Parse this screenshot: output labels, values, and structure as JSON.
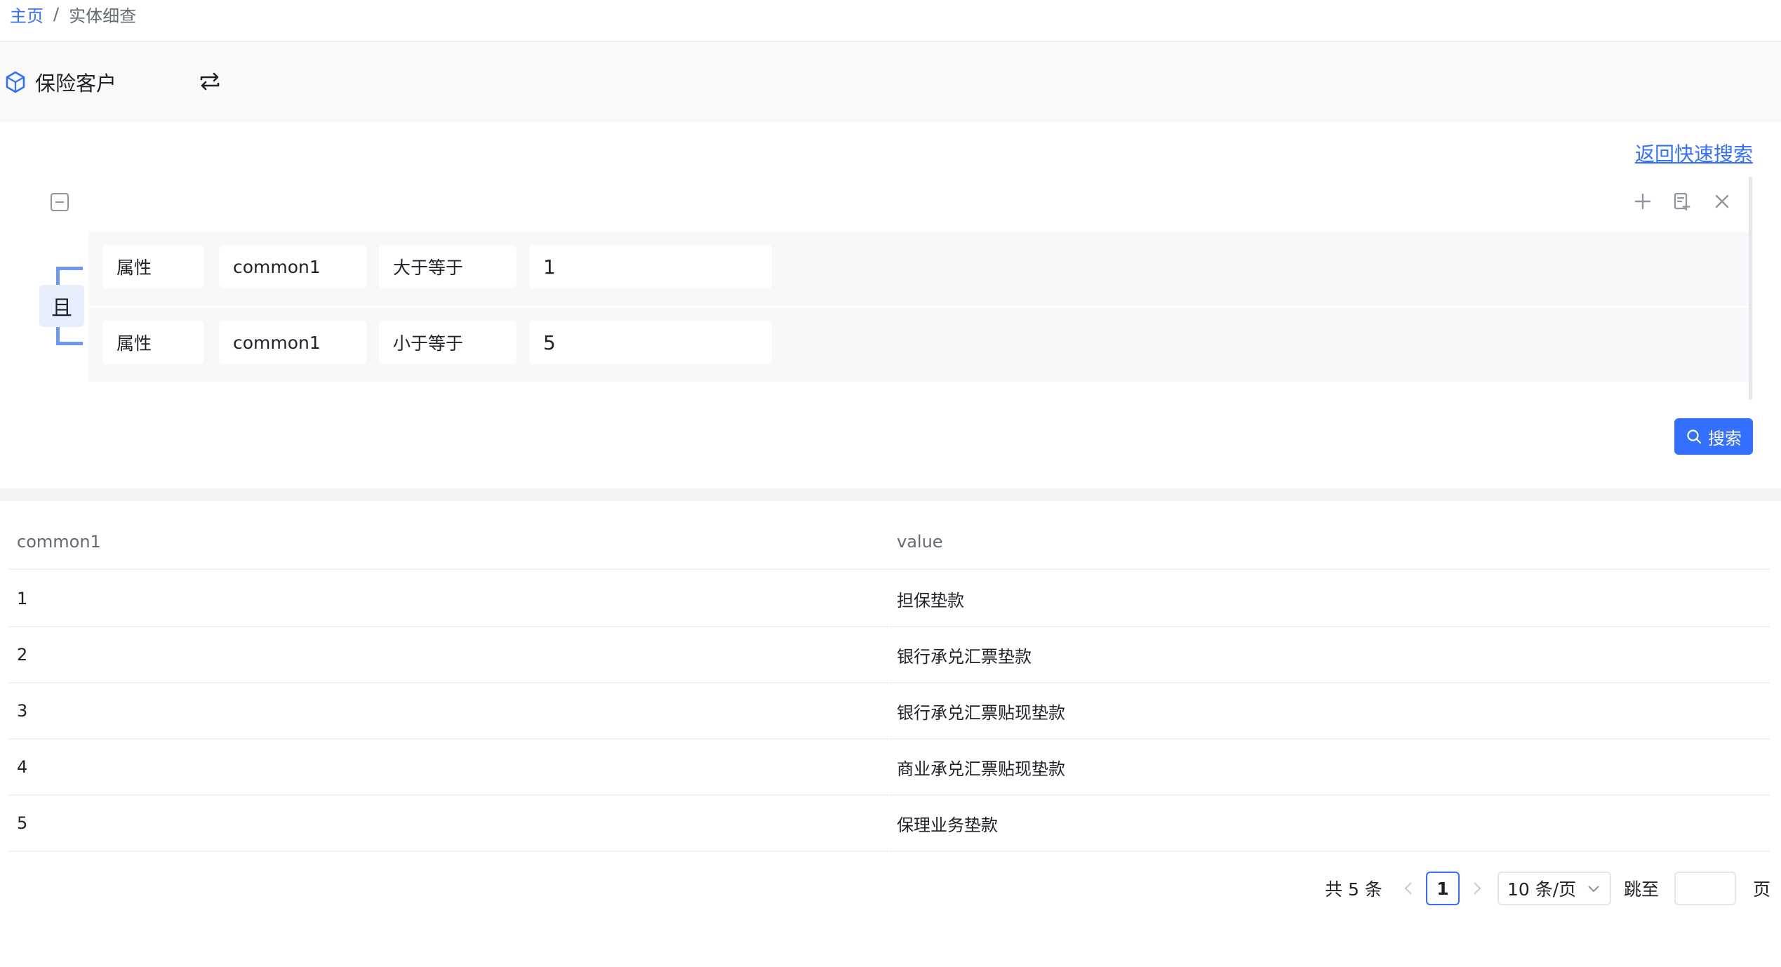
{
  "breadcrumb": {
    "home": "主页",
    "separator": "/",
    "current": "实体细查"
  },
  "entity": {
    "title": "保险客户",
    "icon": "cube-icon",
    "switch_icon": "switch-icon"
  },
  "search_panel": {
    "back_link": "返回快速搜索",
    "logic": "且",
    "conditions": [
      {
        "type": "属性",
        "field": "common1",
        "operator": "大于等于",
        "value": "1"
      },
      {
        "type": "属性",
        "field": "common1",
        "operator": "小于等于",
        "value": "5"
      }
    ],
    "search_button": "搜索",
    "accent": "#3370ff"
  },
  "table": {
    "columns": [
      "common1",
      "value"
    ],
    "rows": [
      [
        "1",
        "担保垫款"
      ],
      [
        "2",
        "银行承兑汇票垫款"
      ],
      [
        "3",
        "银行承兑汇票贴现垫款"
      ],
      [
        "4",
        "商业承兑汇票贴现垫款"
      ],
      [
        "5",
        "保理业务垫款"
      ]
    ]
  },
  "pagination": {
    "total_text": "共 5 条",
    "current_page": "1",
    "page_size": "10 条/页",
    "jump_label": "跳至",
    "jump_value": "",
    "page_unit": "页"
  }
}
